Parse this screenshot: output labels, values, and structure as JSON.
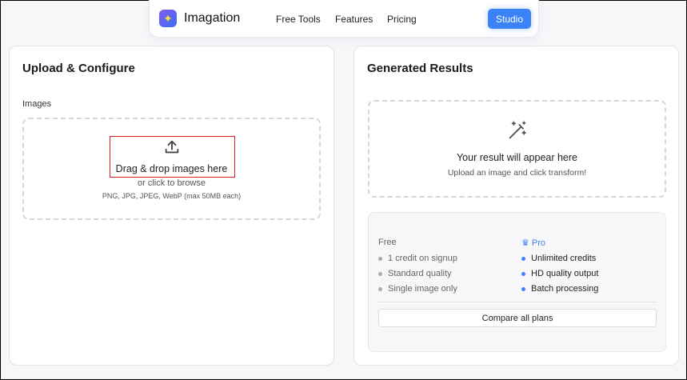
{
  "nav": {
    "brand": "Imagation",
    "links": [
      "Free Tools",
      "Features",
      "Pricing"
    ],
    "studio": "Studio"
  },
  "upload": {
    "title": "Upload & Configure",
    "images_label": "Images",
    "drop_text": "Drag & drop images here",
    "browse": "or click to browse",
    "formats": "PNG, JPG, JPEG, WebP (max 50MB each)"
  },
  "results": {
    "title": "Generated Results",
    "placeholder_title": "Your result will appear here",
    "placeholder_sub": "Upload an image and click transform!",
    "free": {
      "label": "Free",
      "items": [
        "1 credit on signup",
        "Standard quality",
        "Single image only"
      ]
    },
    "pro": {
      "label": "Pro",
      "items": [
        "Unlimited credits",
        "HD quality output",
        "Batch processing"
      ]
    },
    "compare": "Compare all plans"
  },
  "colors": {
    "accent": "#3b82f6",
    "highlight": "#e02020"
  }
}
